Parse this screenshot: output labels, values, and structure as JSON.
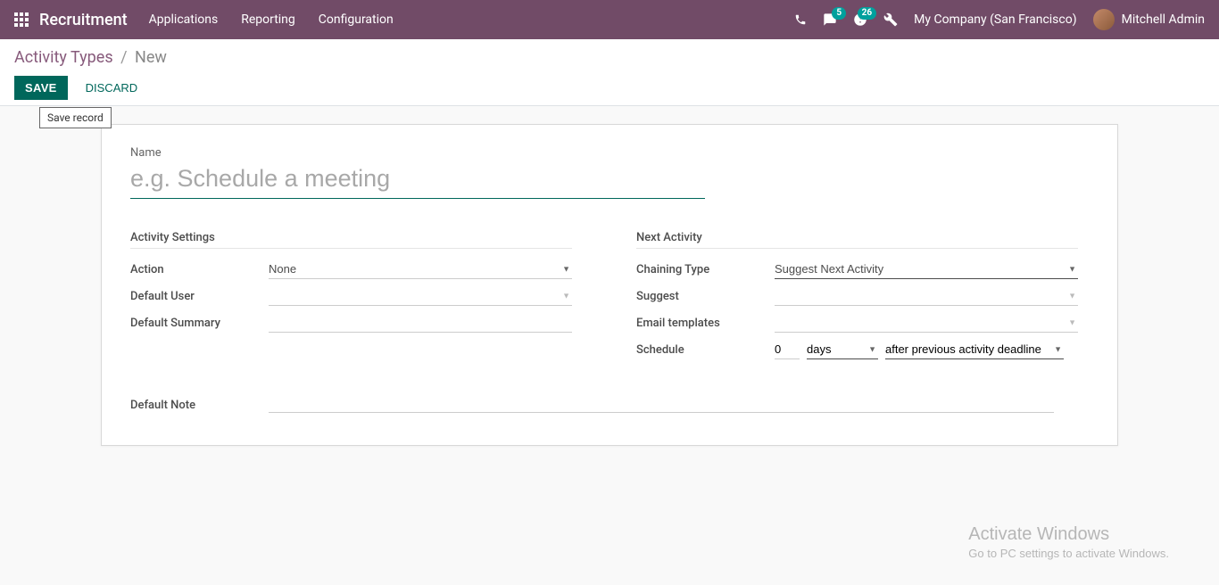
{
  "navbar": {
    "app_name": "Recruitment",
    "links": [
      "Applications",
      "Reporting",
      "Configuration"
    ],
    "messages_badge": "5",
    "activities_badge": "26",
    "company": "My Company (San Francisco)",
    "user_name": "Mitchell Admin"
  },
  "control_panel": {
    "breadcrumb_root": "Activity Types",
    "breadcrumb_current": "New",
    "save_label": "SAVE",
    "discard_label": "DISCARD",
    "save_tooltip": "Save record"
  },
  "form": {
    "name_label": "Name",
    "name_placeholder": "e.g. Schedule a meeting",
    "name_value": "",
    "group1_title": "Activity Settings",
    "action_label": "Action",
    "action_value": "None",
    "default_user_label": "Default User",
    "default_user_value": "",
    "default_summary_label": "Default Summary",
    "default_summary_value": "",
    "group2_title": "Next Activity",
    "chaining_label": "Chaining Type",
    "chaining_value": "Suggest Next Activity",
    "suggest_label": "Suggest",
    "suggest_value": "",
    "email_tpl_label": "Email templates",
    "email_tpl_value": "",
    "schedule_label": "Schedule",
    "schedule_num": "0",
    "schedule_unit": "days",
    "schedule_from": "after previous activity deadline",
    "default_note_label": "Default Note"
  },
  "watermark": {
    "line1": "Activate Windows",
    "line2": "Go to PC settings to activate Windows."
  }
}
